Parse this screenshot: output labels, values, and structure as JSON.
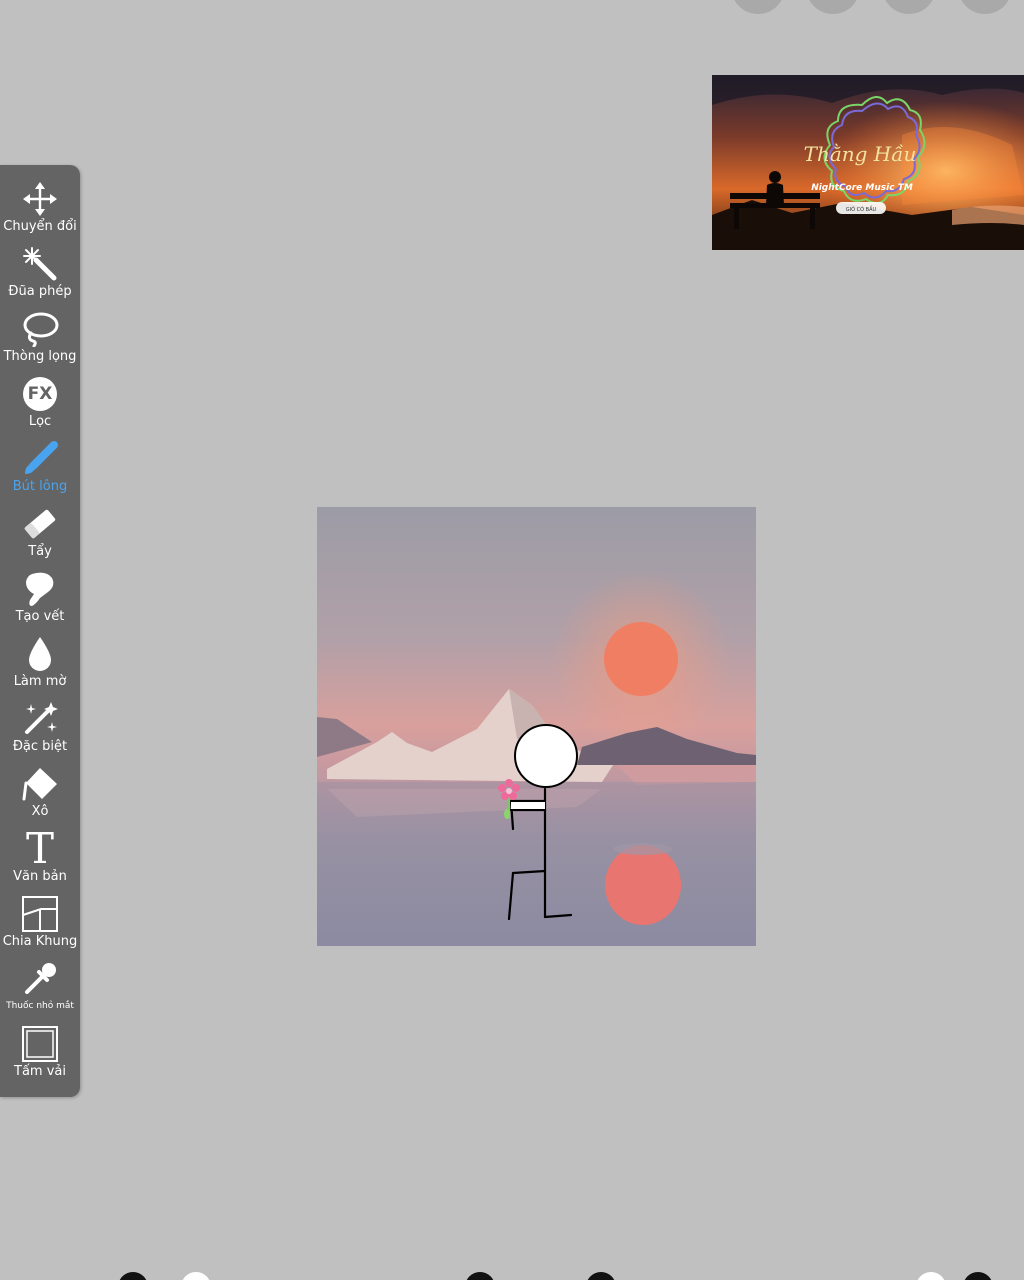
{
  "toolbar": {
    "tools": [
      {
        "label": "Chuyển đổi",
        "icon": "move-icon"
      },
      {
        "label": "Đũa phép",
        "icon": "magic-wand-icon"
      },
      {
        "label": "Thòng lọng",
        "icon": "lasso-icon"
      },
      {
        "label": "Lọc",
        "icon": "fx-icon",
        "glyph": "FX"
      },
      {
        "label": "Bút lông",
        "icon": "brush-icon",
        "active": true
      },
      {
        "label": "Tẩy",
        "icon": "eraser-icon"
      },
      {
        "label": "Tạo vết",
        "icon": "smudge-icon"
      },
      {
        "label": "Làm mờ",
        "icon": "blur-drop-icon"
      },
      {
        "label": "Đặc biệt",
        "icon": "special-sparkle-icon"
      },
      {
        "label": "Xô",
        "icon": "bucket-icon"
      },
      {
        "label": "Văn bản",
        "icon": "text-icon",
        "glyph": "T"
      },
      {
        "label": "Chia Khung",
        "icon": "frame-divider-icon"
      },
      {
        "label": "Thuốc nhỏ mắt",
        "icon": "eyedropper-icon"
      },
      {
        "label": "Tấm vải",
        "icon": "canvas-icon"
      }
    ]
  },
  "reference": {
    "title": "Thằng Hầu",
    "subtitle": "NightCore Music TM",
    "tag": "GIÓ CÓ BẦU"
  },
  "colors": {
    "background": "#c0c0c0",
    "toolbar": "#646464",
    "active": "#4aa3ee"
  }
}
